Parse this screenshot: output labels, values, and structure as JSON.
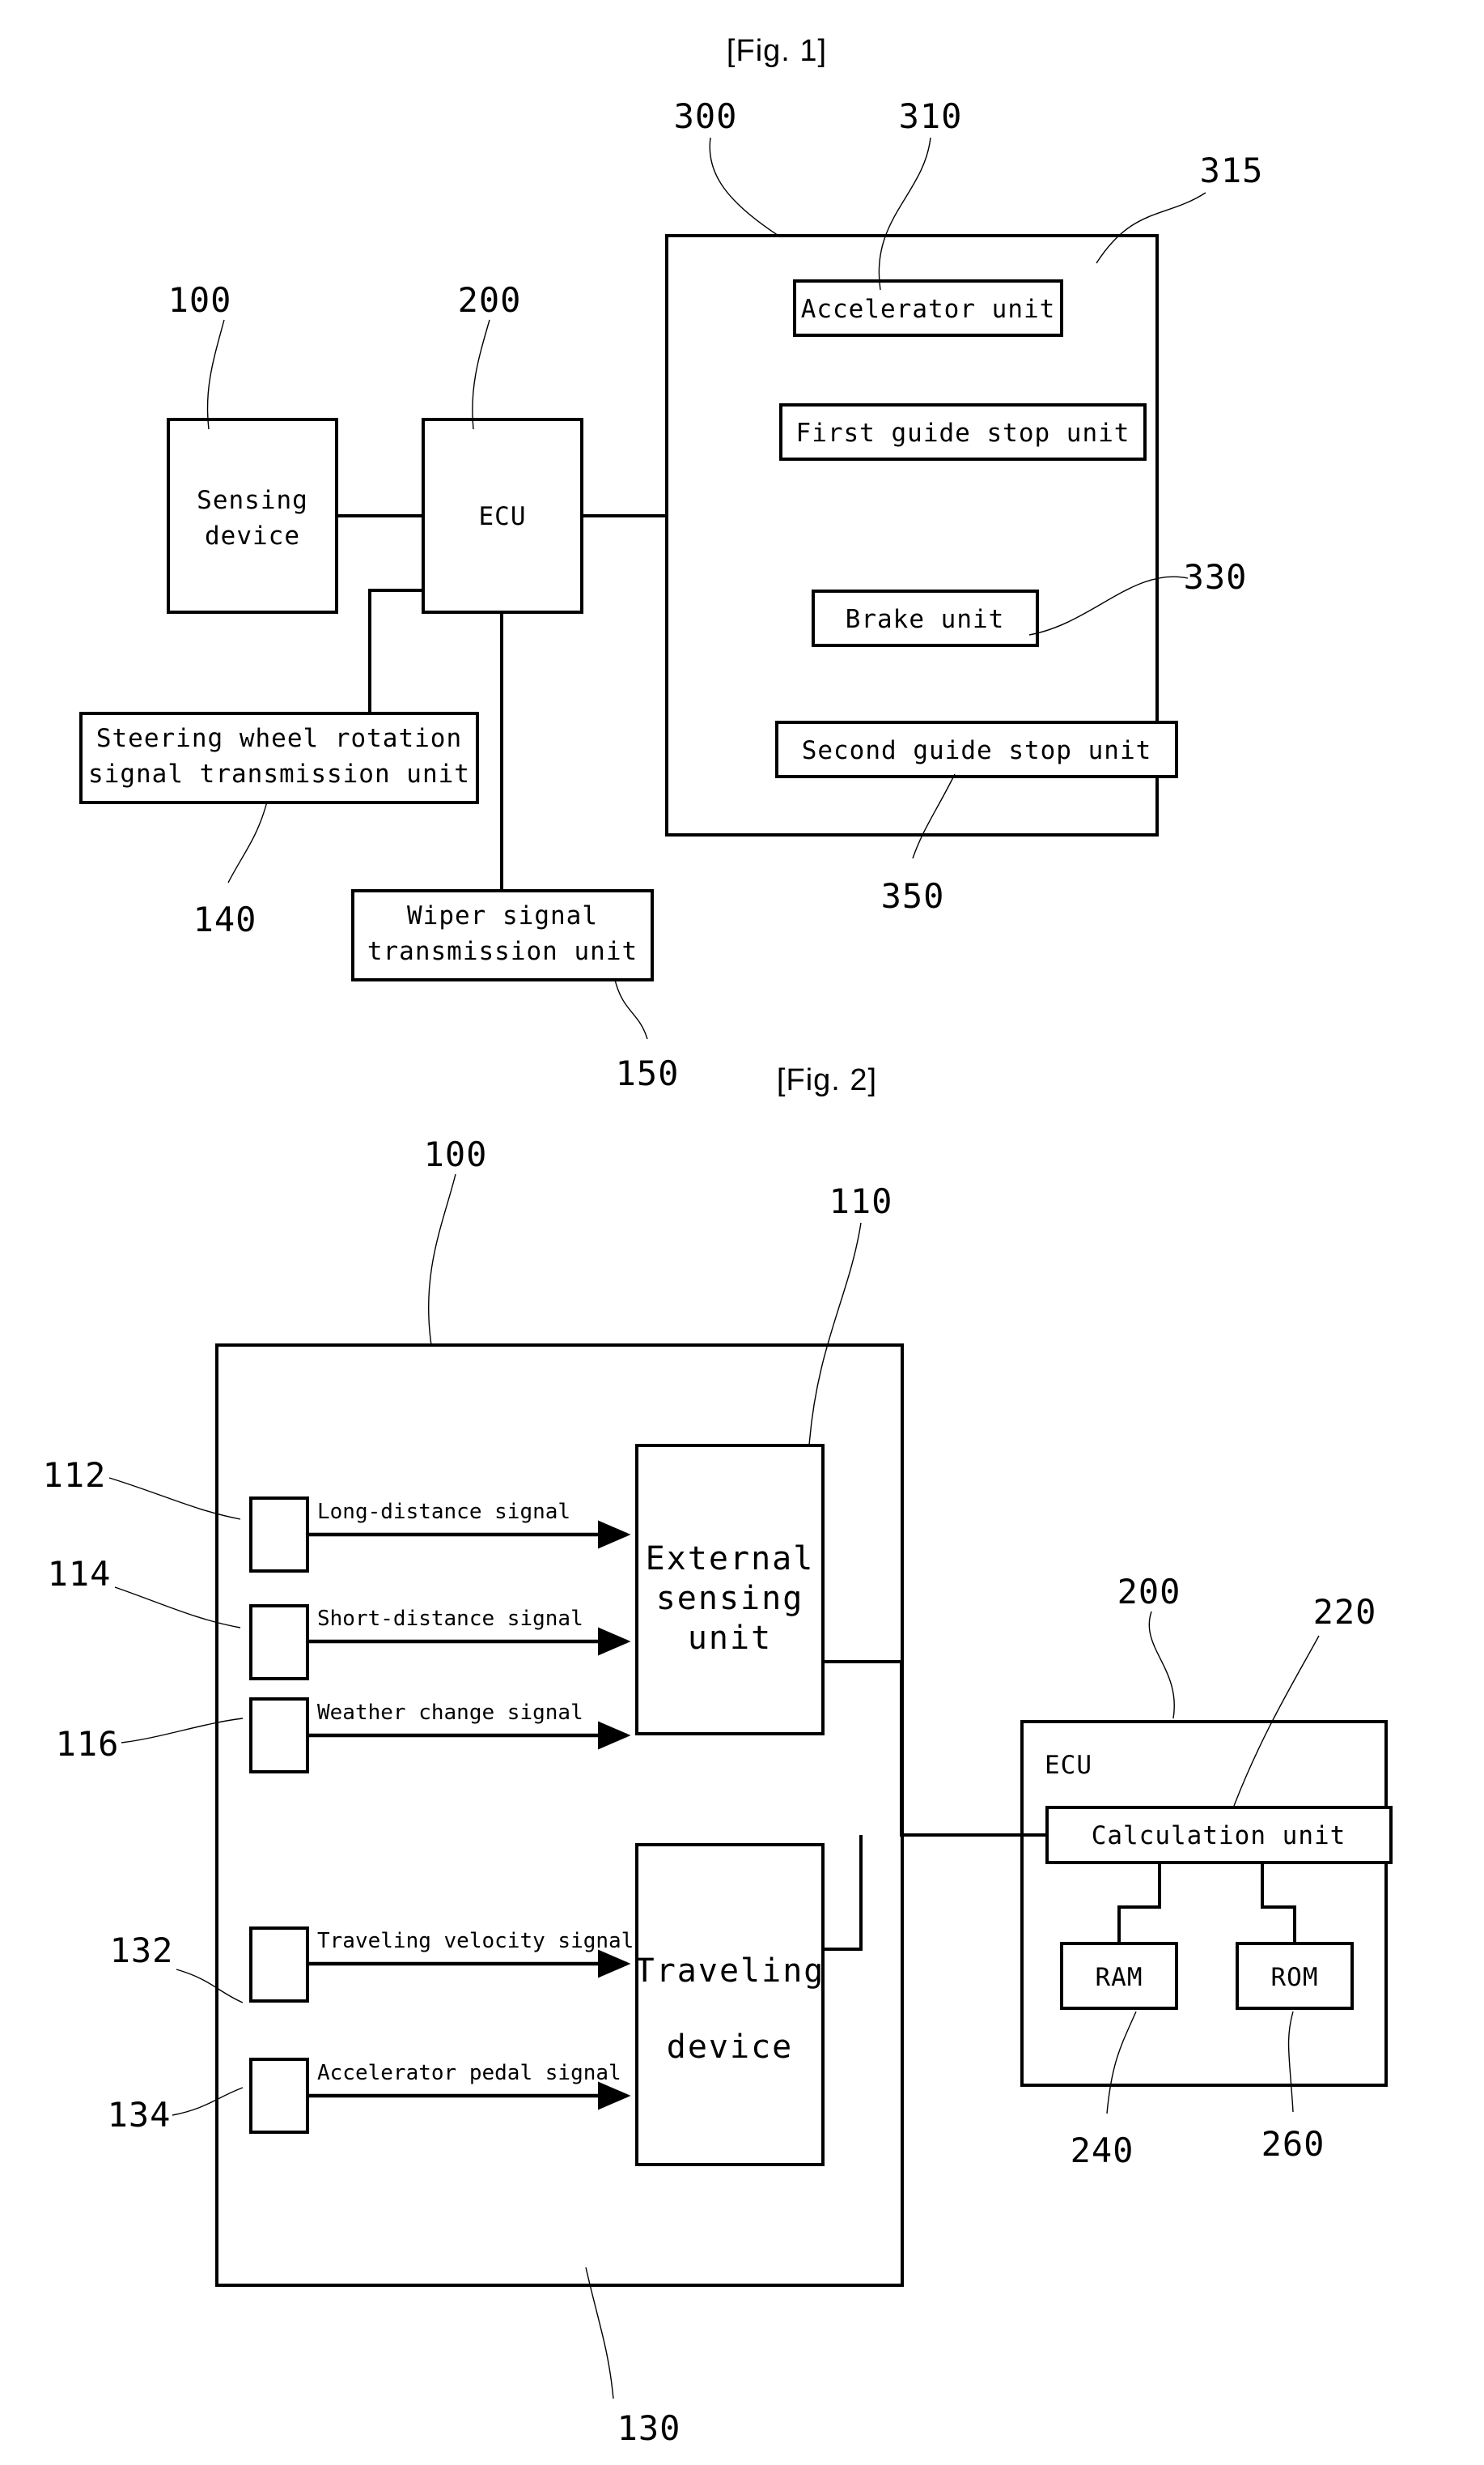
{
  "document": {
    "type": "patent-drawing-sheet",
    "figures": [
      {
        "title": "[Fig. 1]",
        "boxes": [
          {
            "id": "sensing-device",
            "label": "Sensing\ndevice",
            "line1": "Sensing",
            "line2": "device",
            "ref": "100"
          },
          {
            "id": "ecu",
            "label": "ECU",
            "ref": "200"
          },
          {
            "id": "steering-wheel-unit",
            "line1": "Steering wheel rotation",
            "line2": "signal transmission unit",
            "ref": "140"
          },
          {
            "id": "wiper-unit",
            "line1": "Wiper signal",
            "line2": "transmission unit",
            "ref": "150"
          },
          {
            "id": "outer-container",
            "label": "",
            "ref": "300"
          },
          {
            "id": "accelerator-unit",
            "label": "Accelerator unit",
            "ref": "310"
          },
          {
            "id": "first-guide-stop-unit",
            "label": "First guide stop unit",
            "ref": "315"
          },
          {
            "id": "brake-unit",
            "label": "Brake unit",
            "ref": "330"
          },
          {
            "id": "second-guide-stop-unit",
            "label": "Second guide stop unit",
            "ref": "350"
          }
        ],
        "reference_numerals": [
          "100",
          "200",
          "300",
          "310",
          "315",
          "330",
          "350",
          "140",
          "150"
        ]
      },
      {
        "title": "[Fig. 2]",
        "boxes": [
          {
            "id": "sensing-device-container",
            "label": "",
            "ref": "100"
          },
          {
            "id": "external-sensing-unit",
            "line1": "External",
            "line2": "sensing",
            "line3": "unit",
            "ref": "110"
          },
          {
            "id": "traveling-device",
            "line1": "Traveling",
            "line2": "device",
            "ref": "130"
          },
          {
            "id": "ecu-container",
            "label": "ECU",
            "ref": "200"
          },
          {
            "id": "calculation-unit",
            "label": "Calculation unit",
            "ref": "220"
          },
          {
            "id": "ram",
            "label": "RAM",
            "ref": "240"
          },
          {
            "id": "rom",
            "label": "ROM",
            "ref": "260"
          }
        ],
        "signals": [
          {
            "id": "long-distance",
            "label": "Long-distance signal",
            "ref": "112"
          },
          {
            "id": "short-distance",
            "label": "Short-distance signal",
            "ref": "114"
          },
          {
            "id": "weather-change",
            "label": "Weather change signal",
            "ref": "116"
          },
          {
            "id": "traveling-velocity",
            "label": "Traveling velocity signal",
            "ref": "132"
          },
          {
            "id": "accelerator-pedal",
            "label": "Accelerator pedal signal",
            "ref": "134"
          }
        ],
        "reference_numerals": [
          "100",
          "110",
          "112",
          "114",
          "116",
          "130",
          "132",
          "134",
          "200",
          "220",
          "240",
          "260"
        ]
      }
    ],
    "colors": {
      "ink": "#000000",
      "paper": "#ffffff"
    }
  }
}
